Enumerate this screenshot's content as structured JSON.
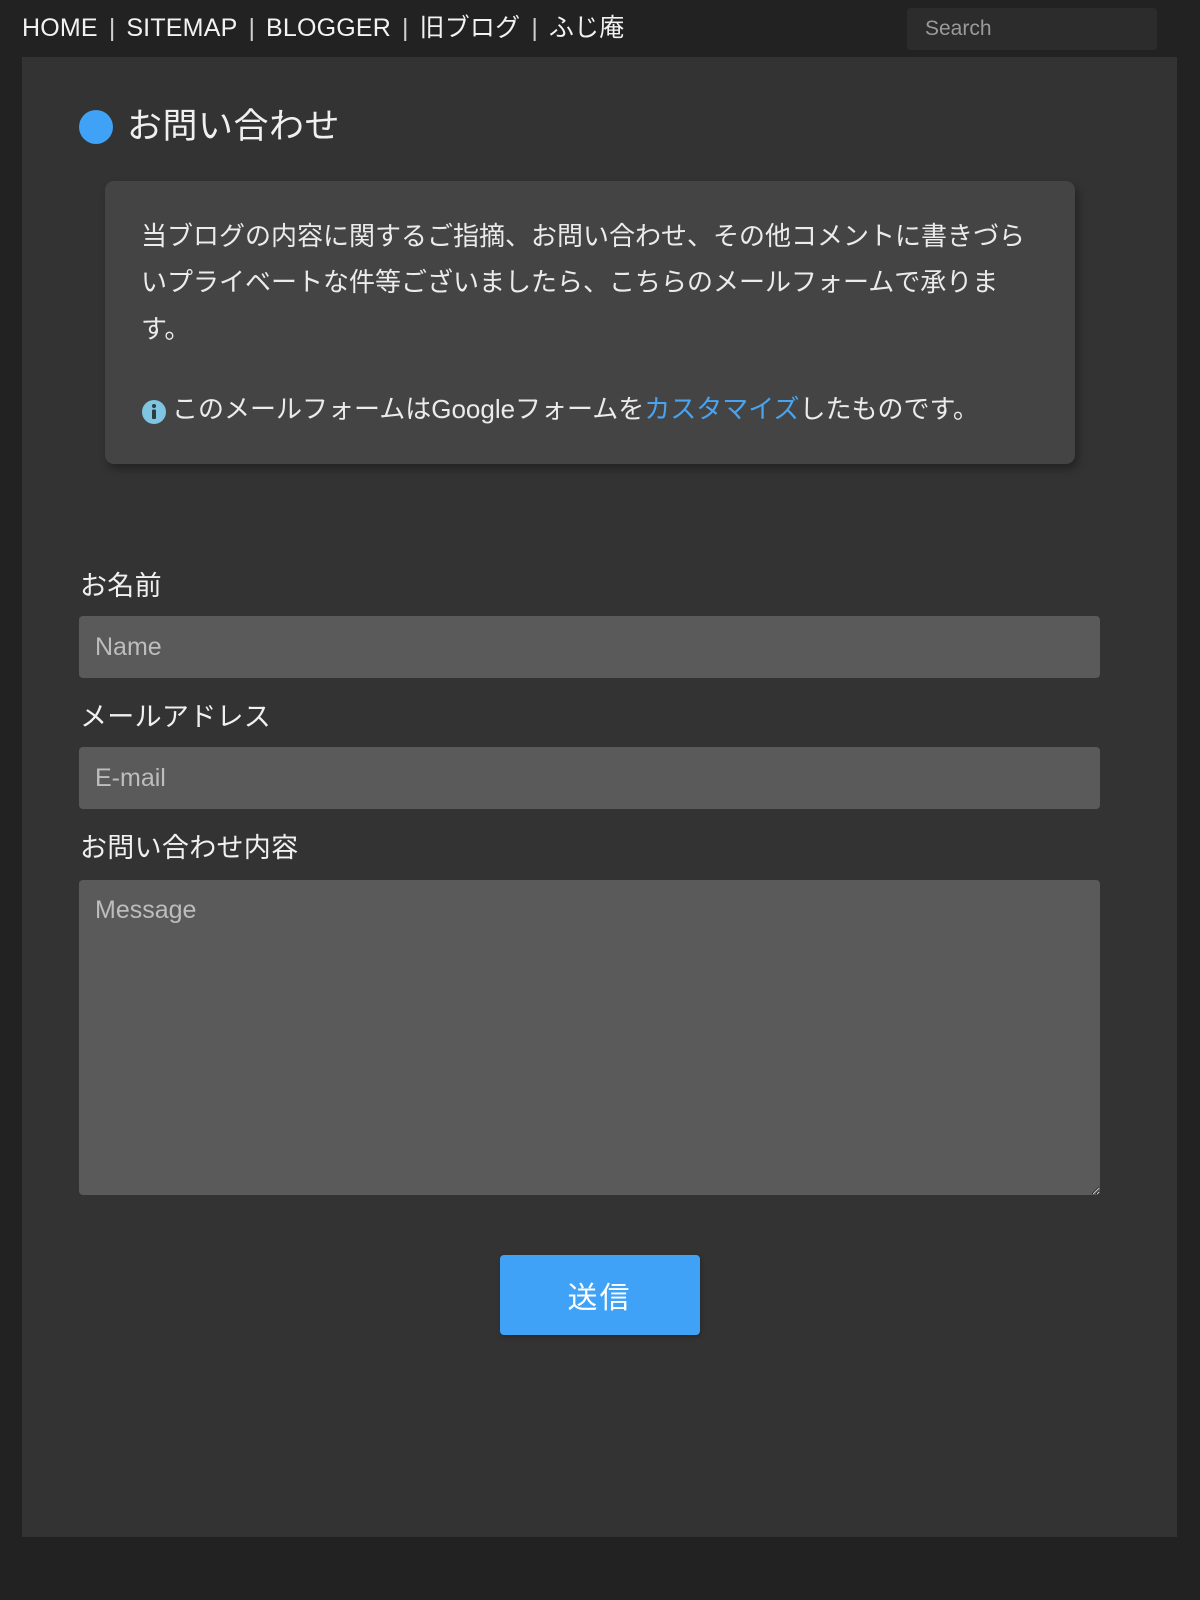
{
  "colors": {
    "page_background": "#222222",
    "container_background": "#333333",
    "card_background": "#444444",
    "input_background": "#5a5a5a",
    "accent_blue": "#3fa2f7",
    "link_blue": "#4aa3ef",
    "info_icon_blue": "#7fc4e0",
    "text_primary": "#f0f0f0",
    "placeholder": "#bdbdbd"
  },
  "topbar": {
    "nav_items": [
      {
        "label": "HOME",
        "icon": ""
      },
      {
        "label": "SITEMAP",
        "icon": ""
      },
      {
        "label": "BLOGGER",
        "icon": ""
      },
      {
        "label": "旧ブログ",
        "icon": ""
      },
      {
        "label": "ふじ庵",
        "icon": ""
      }
    ],
    "separator": "|",
    "search": {
      "placeholder": "Search",
      "value": "",
      "icon": "search-icon"
    }
  },
  "page": {
    "bullet_icon": "filled-circle-icon",
    "title": "お問い合わせ"
  },
  "info_card": {
    "paragraph": "当ブログの内容に関するご指摘、お問い合わせ、その他コメントに書きづらいプライベートな件等ございましたら、こちらのメールフォームで承ります。",
    "note": {
      "icon": "info-circle-icon",
      "text_before_link": "このメールフォームはGoogleフォームを",
      "link_label": "カスタマイズ",
      "text_after_link": "したものです。"
    }
  },
  "form": {
    "fields": [
      {
        "label": "お名前",
        "placeholder": "Name",
        "value": "",
        "type": "text"
      },
      {
        "label": "メールアドレス",
        "placeholder": "E-mail",
        "value": "",
        "type": "email"
      },
      {
        "label": "お問い合わせ内容",
        "placeholder": "Message",
        "value": "",
        "type": "textarea"
      }
    ],
    "submit_label": "送信"
  }
}
